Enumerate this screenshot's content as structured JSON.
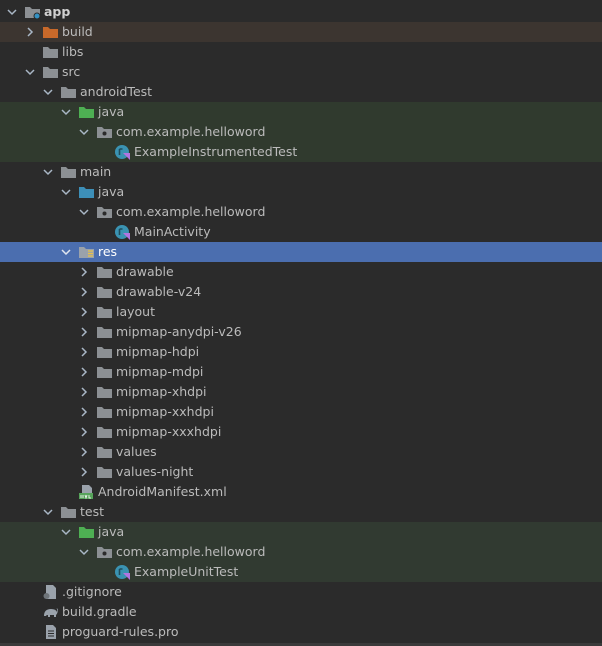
{
  "project_tree": {
    "items": [
      {
        "label": "app",
        "depth": 0,
        "arrow": "down",
        "icon": "module-folder-icon"
      },
      {
        "label": "build",
        "depth": 1,
        "arrow": "right",
        "icon": "excluded-folder-icon"
      },
      {
        "label": "libs",
        "depth": 1,
        "arrow": "none",
        "icon": "folder-icon"
      },
      {
        "label": "src",
        "depth": 1,
        "arrow": "down",
        "icon": "folder-icon"
      },
      {
        "label": "androidTest",
        "depth": 2,
        "arrow": "down",
        "icon": "folder-icon"
      },
      {
        "label": "java",
        "depth": 3,
        "arrow": "down",
        "icon": "test-source-folder-icon"
      },
      {
        "label": "com.example.helloword",
        "depth": 4,
        "arrow": "down",
        "icon": "package-icon"
      },
      {
        "label": "ExampleInstrumentedTest",
        "depth": 5,
        "arrow": "none",
        "icon": "kotlin-class-icon"
      },
      {
        "label": "main",
        "depth": 2,
        "arrow": "down",
        "icon": "folder-icon"
      },
      {
        "label": "java",
        "depth": 3,
        "arrow": "down",
        "icon": "source-folder-icon"
      },
      {
        "label": "com.example.helloword",
        "depth": 4,
        "arrow": "down",
        "icon": "package-icon"
      },
      {
        "label": "MainActivity",
        "depth": 5,
        "arrow": "none",
        "icon": "kotlin-class-icon"
      },
      {
        "label": "res",
        "depth": 3,
        "arrow": "down",
        "icon": "resource-folder-icon"
      },
      {
        "label": "drawable",
        "depth": 4,
        "arrow": "right",
        "icon": "folder-icon"
      },
      {
        "label": "drawable-v24",
        "depth": 4,
        "arrow": "right",
        "icon": "folder-icon"
      },
      {
        "label": "layout",
        "depth": 4,
        "arrow": "right",
        "icon": "folder-icon"
      },
      {
        "label": "mipmap-anydpi-v26",
        "depth": 4,
        "arrow": "right",
        "icon": "folder-icon"
      },
      {
        "label": "mipmap-hdpi",
        "depth": 4,
        "arrow": "right",
        "icon": "folder-icon"
      },
      {
        "label": "mipmap-mdpi",
        "depth": 4,
        "arrow": "right",
        "icon": "folder-icon"
      },
      {
        "label": "mipmap-xhdpi",
        "depth": 4,
        "arrow": "right",
        "icon": "folder-icon"
      },
      {
        "label": "mipmap-xxhdpi",
        "depth": 4,
        "arrow": "right",
        "icon": "folder-icon"
      },
      {
        "label": "mipmap-xxxhdpi",
        "depth": 4,
        "arrow": "right",
        "icon": "folder-icon"
      },
      {
        "label": "values",
        "depth": 4,
        "arrow": "right",
        "icon": "folder-icon"
      },
      {
        "label": "values-night",
        "depth": 4,
        "arrow": "right",
        "icon": "folder-icon"
      },
      {
        "label": "AndroidManifest.xml",
        "depth": 3,
        "arrow": "none",
        "icon": "manifest-file-icon"
      },
      {
        "label": "test",
        "depth": 2,
        "arrow": "down",
        "icon": "folder-icon"
      },
      {
        "label": "java",
        "depth": 3,
        "arrow": "down",
        "icon": "test-source-folder-icon"
      },
      {
        "label": "com.example.helloword",
        "depth": 4,
        "arrow": "down",
        "icon": "package-icon"
      },
      {
        "label": "ExampleUnitTest",
        "depth": 5,
        "arrow": "none",
        "icon": "kotlin-class-icon"
      },
      {
        "label": ".gitignore",
        "depth": 1,
        "arrow": "none",
        "icon": "gitignore-file-icon"
      },
      {
        "label": "build.gradle",
        "depth": 1,
        "arrow": "none",
        "icon": "gradle-file-icon"
      },
      {
        "label": "proguard-rules.pro",
        "depth": 1,
        "arrow": "none",
        "icon": "text-file-icon"
      }
    ]
  },
  "colors": {
    "background": "#2b2b2b",
    "selected_row": "#4b6eaf",
    "test_row": "#303a2e",
    "excluded_row": "#3c3530",
    "folder": "#8c9094",
    "excluded_folder": "#c8692a",
    "test_folder": "#4eaf53",
    "source_folder": "#3d8fb8",
    "text": "#bbbbbb"
  }
}
